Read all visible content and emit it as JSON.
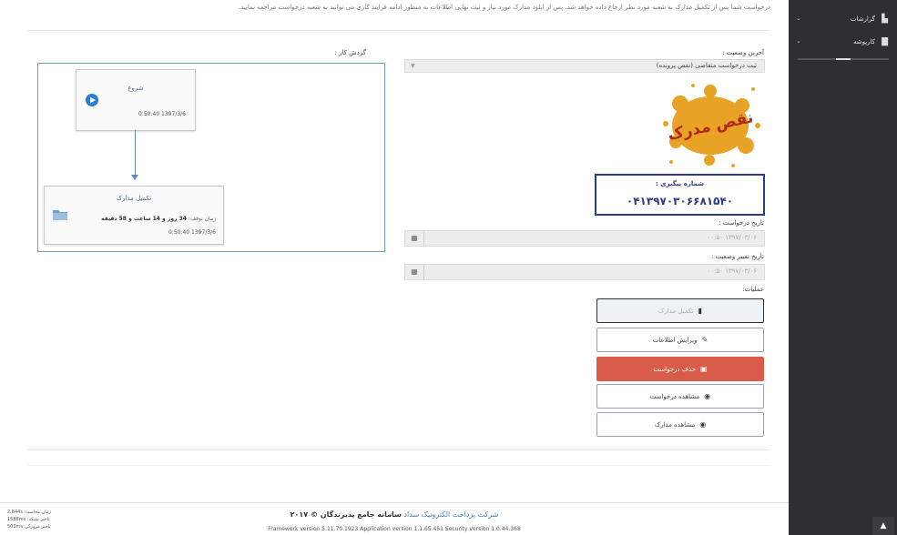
{
  "notice": "درخواست شما پس از تکمیل مدارک به شعبه مورد نظر ارجاع داده خواهد شد. پس از اپلود مدارک مورد نیاز و ثبت نهایی اطلاعات به منظور ادامه فرایند کاری می توانید به شعبه درخواست مراجعه نمایید.",
  "sidebar": {
    "items": [
      {
        "label": "گزارشات",
        "icon": "chart-icon"
      },
      {
        "label": "کارپوشه",
        "icon": "briefcase-icon"
      }
    ]
  },
  "status": {
    "label": "آخرین وضعیت :",
    "value": "ثبت درخواست متقاضی (نقص پرونده)"
  },
  "stamp": {
    "text": "نقص مدرک",
    "color": "#e8a326"
  },
  "tracking": {
    "label": "شماره پیگیری :",
    "number": "۰۴۱۳۹۷۰۳۰۶۶۸۱۵۴۰"
  },
  "request_date": {
    "label": "تاریخ درخواست :",
    "value": "۰۰:۵۰ ۱۳۹۷/۰۳/۰۶"
  },
  "change_date": {
    "label": "تاریخ تغییر وضعیت :",
    "value": "۰۰:۵۰ ۱۳۹۷/۰۳/۰۶"
  },
  "operations": {
    "label": "عملیات:",
    "buttons": [
      {
        "label": "تکمیل مدارک",
        "icon": "book-icon"
      },
      {
        "label": "ویرایش اطلاعات",
        "icon": "edit-icon"
      },
      {
        "label": "حذف درخواست",
        "icon": "trash-icon"
      },
      {
        "label": "مشاهده درخواست",
        "icon": "eye-icon"
      },
      {
        "label": "مشاهده مدارک",
        "icon": "eye-icon"
      }
    ]
  },
  "workflow": {
    "label": "گردش کار :",
    "start": {
      "title": "شروع",
      "date": "0:50:40 1397/3/6"
    },
    "complete": {
      "title": "تکمیل مدارک",
      "stop_label": "زمان توقف:",
      "stop_value": "34 روز و 14 ساعت و 58 دقیقه",
      "date": "0:50:40 1397/3/6"
    }
  },
  "footer": {
    "brand": "شرکت پرداخت الکترونیک سداد",
    "title": "سامانه جامع پذیرندگان © ۲۰۱۷",
    "versions": "Framework version 5.11.70.1923 Application version 1.1.65.451 Security version 1.0.44.368"
  },
  "timing": {
    "calc": "زمان محاسبه: 2.844s",
    "network": "تاخیر شبکه: 1588ms",
    "browser": "تاخیر مرورگر: 503ms"
  },
  "colors": {
    "sidebar": "#2d3033",
    "danger": "#d95b4a",
    "brand": "#4a7fbf",
    "tracking": "#2d3a8c"
  }
}
